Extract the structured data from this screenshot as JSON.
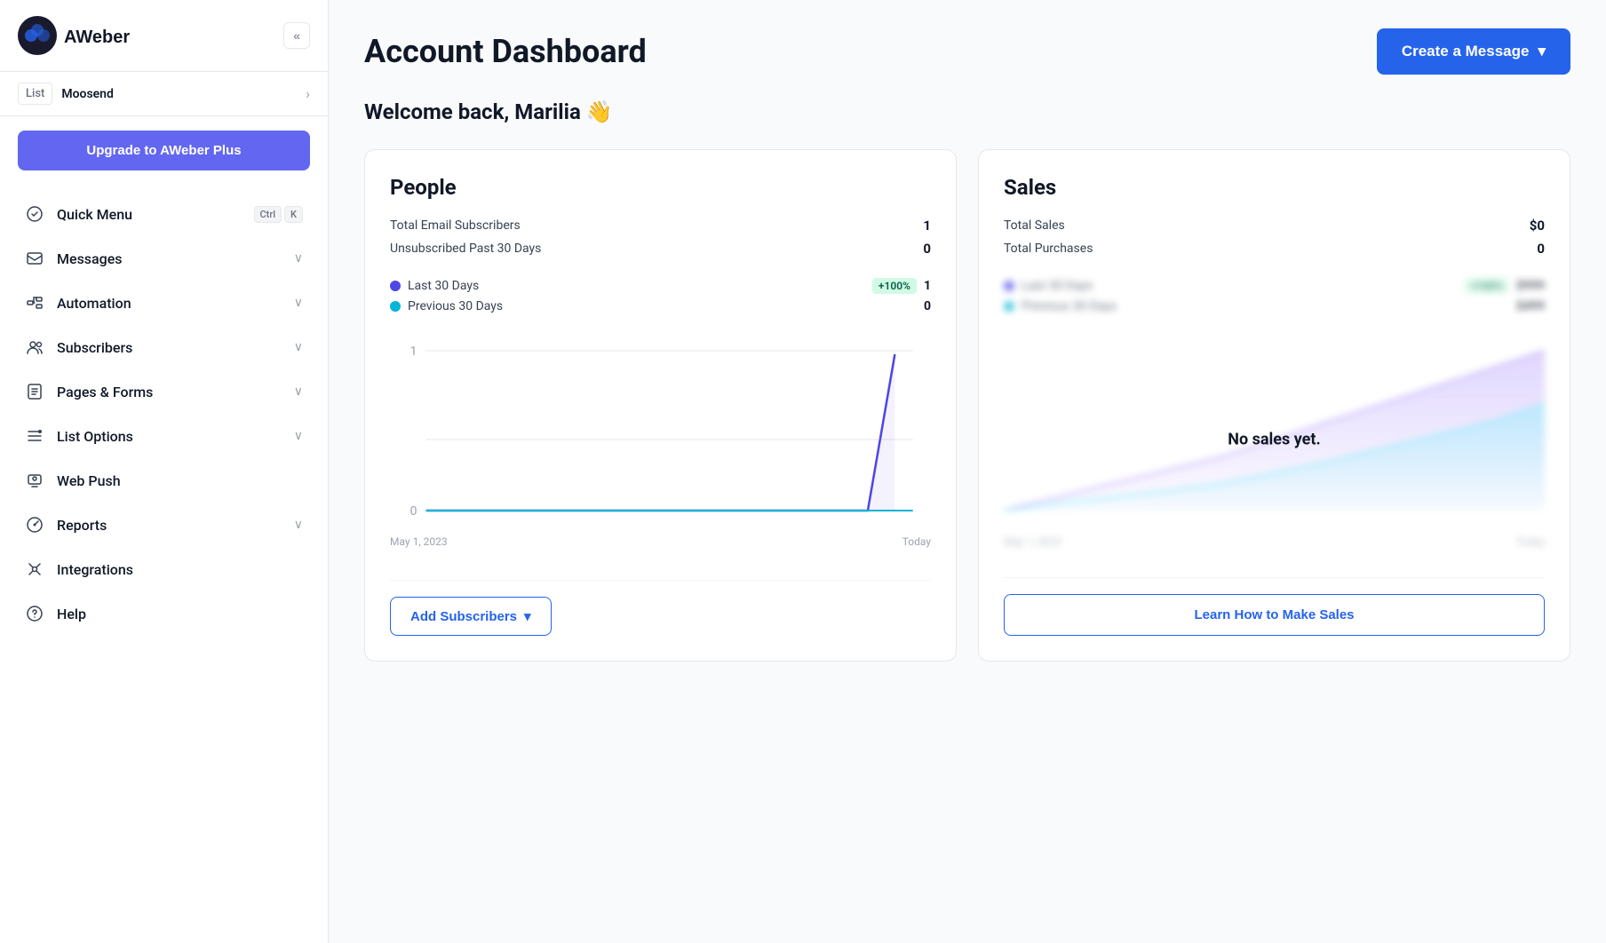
{
  "sidebar": {
    "logo_alt": "AWeber",
    "collapse_label": "«",
    "list": {
      "label": "List",
      "name": "Moosend",
      "arrow": "›"
    },
    "upgrade_btn": "Upgrade to AWeber Plus",
    "nav_items": [
      {
        "id": "quick-menu",
        "label": "Quick Menu",
        "shortcut": [
          "Ctrl",
          "K"
        ],
        "has_chevron": false
      },
      {
        "id": "messages",
        "label": "Messages",
        "has_chevron": true
      },
      {
        "id": "automation",
        "label": "Automation",
        "has_chevron": true
      },
      {
        "id": "subscribers",
        "label": "Subscribers",
        "has_chevron": true
      },
      {
        "id": "pages-forms",
        "label": "Pages & Forms",
        "has_chevron": true
      },
      {
        "id": "list-options",
        "label": "List Options",
        "has_chevron": true
      },
      {
        "id": "web-push",
        "label": "Web Push",
        "has_chevron": false
      },
      {
        "id": "reports",
        "label": "Reports",
        "has_chevron": true
      },
      {
        "id": "integrations",
        "label": "Integrations",
        "has_chevron": false
      },
      {
        "id": "help",
        "label": "Help",
        "has_chevron": false
      }
    ]
  },
  "header": {
    "title": "Account Dashboard",
    "create_btn": "Create a Message"
  },
  "welcome": "Welcome back, Marilia 👋",
  "people_card": {
    "title": "People",
    "stats": [
      {
        "label": "Total Email Subscribers",
        "value": "1"
      },
      {
        "label": "Unsubscribed Past 30 Days",
        "value": "0"
      }
    ],
    "legend": [
      {
        "label": "Last 30 Days",
        "color": "#4f46e5",
        "badge": "+100%",
        "value": "1"
      },
      {
        "label": "Previous 30 Days",
        "color": "#06b6d4",
        "badge": null,
        "value": "0"
      }
    ],
    "chart": {
      "y_labels": [
        "1",
        "0"
      ],
      "x_labels": [
        "May 1, 2023",
        "Today"
      ]
    },
    "footer_btn": "Add Subscribers",
    "footer_chevron": "▾"
  },
  "sales_card": {
    "title": "Sales",
    "stats": [
      {
        "label": "Total Sales",
        "value": "$0"
      },
      {
        "label": "Total Purchases",
        "value": "0"
      }
    ],
    "no_sales_text": "No sales yet.",
    "footer_btn": "Learn How to Make Sales"
  }
}
